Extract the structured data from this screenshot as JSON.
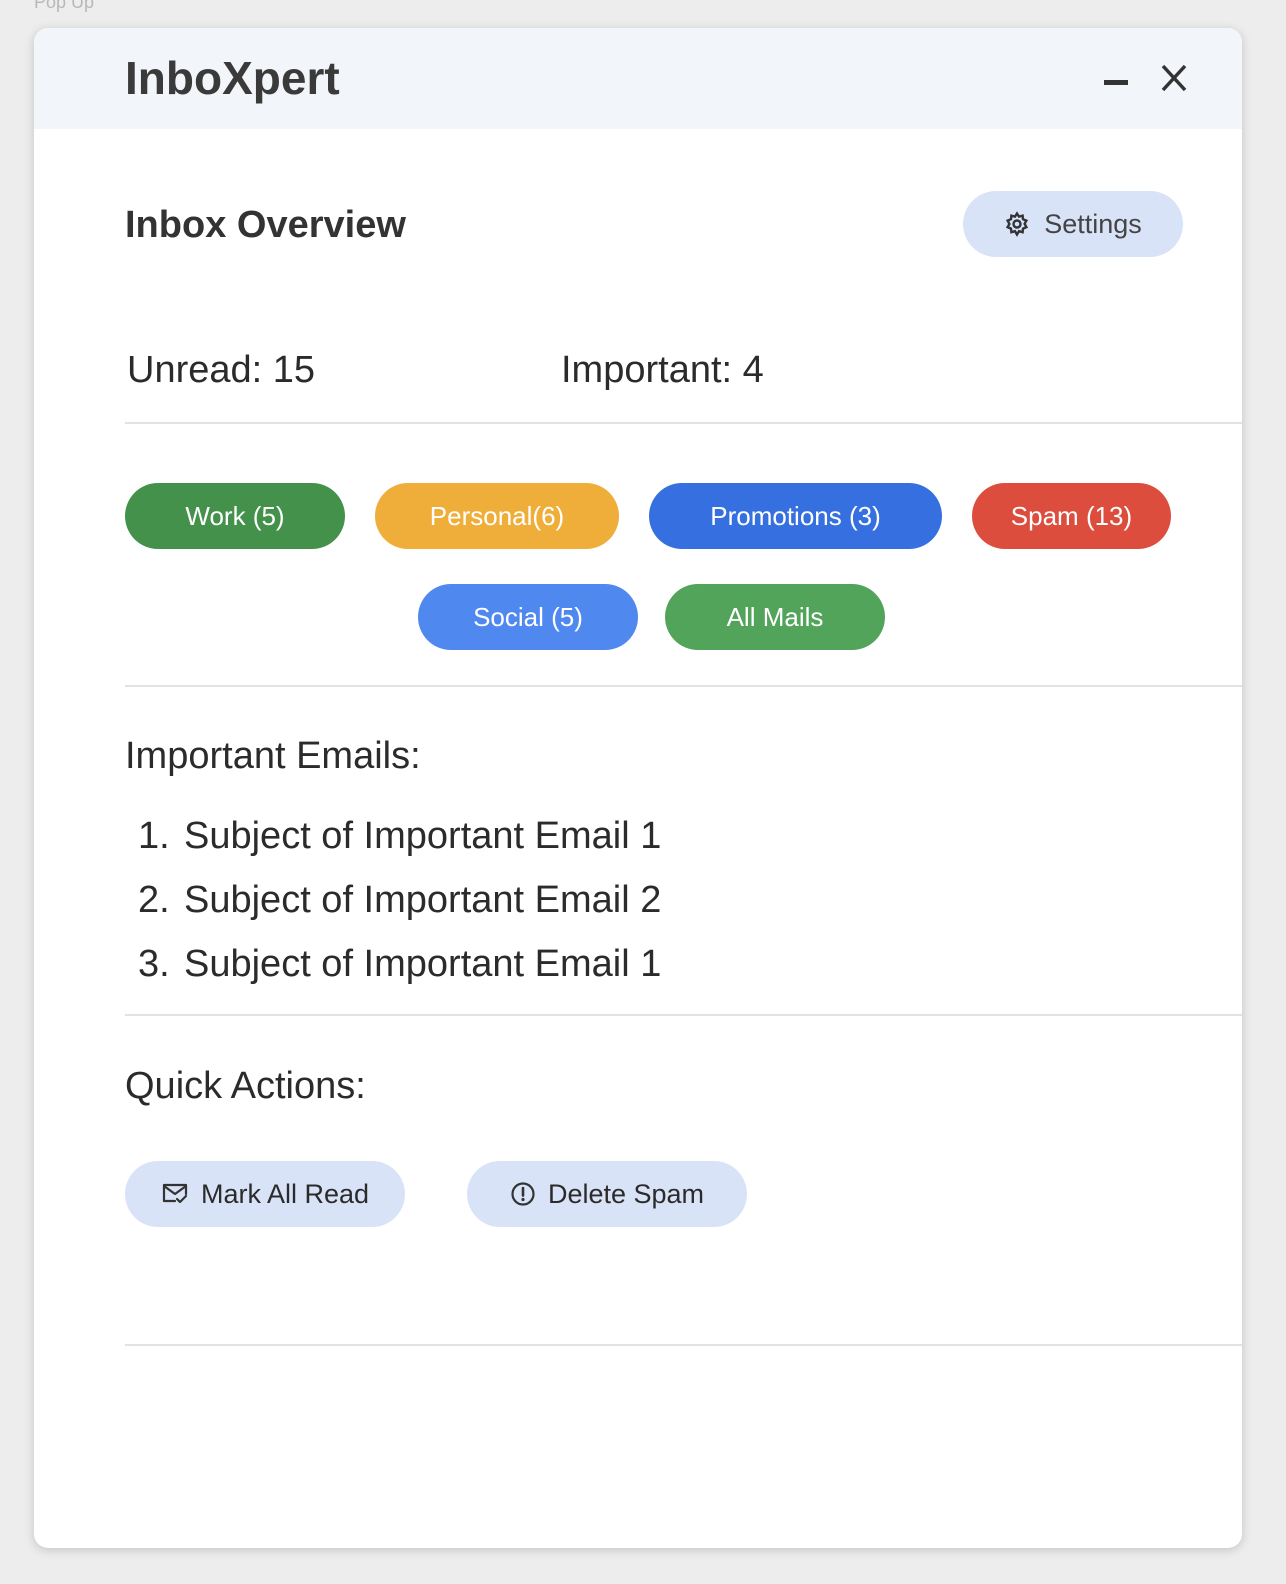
{
  "frame_label": "Pop Up",
  "app": {
    "title": "InboXpert"
  },
  "overview": {
    "title": "Inbox Overview",
    "settings_label": "Settings",
    "unread": "Unread: 15",
    "important": "Important: 4"
  },
  "categories": [
    {
      "label": "Work (5)",
      "color": "#43914a"
    },
    {
      "label": "Personal(6)",
      "color": "#eeae39"
    },
    {
      "label": "Promotions (3)",
      "color": "#3670e0"
    },
    {
      "label": "Spam (13)",
      "color": "#dc4d3d"
    },
    {
      "label": "Social (5)",
      "color": "#4f88ef"
    },
    {
      "label": "All Mails",
      "color": "#52a45a"
    }
  ],
  "important_emails": {
    "heading": "Important Emails:",
    "items": [
      {
        "num": "1.",
        "subject": "Subject of Important Email 1"
      },
      {
        "num": "2.",
        "subject": "Subject of Important Email 2"
      },
      {
        "num": "3.",
        "subject": "Subject of Important Email 1"
      }
    ]
  },
  "quick_actions": {
    "heading": "Quick Actions:",
    "mark_all_read": "Mark All Read",
    "delete_spam": "Delete Spam"
  },
  "icons": {
    "minimize": "minimize-icon",
    "close": "close-icon",
    "settings": "gear-icon",
    "mark_read": "mail-check-icon",
    "delete_spam": "alert-circle-icon"
  }
}
